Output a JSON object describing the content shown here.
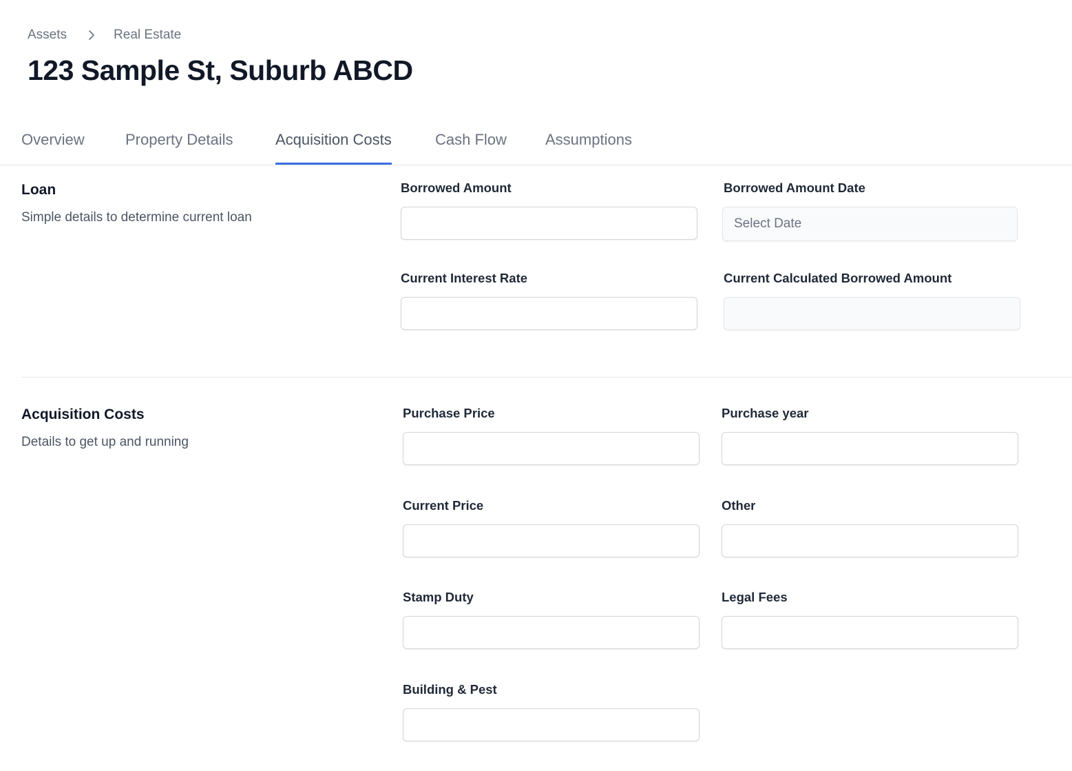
{
  "breadcrumb": {
    "items": [
      "Assets",
      "Real Estate"
    ]
  },
  "header": {
    "title": "123 Sample St, Suburb ABCD"
  },
  "tabs": [
    {
      "label": "Overview",
      "active": false
    },
    {
      "label": "Property Details",
      "active": false
    },
    {
      "label": "Acquisition Costs",
      "active": true
    },
    {
      "label": "Cash Flow",
      "active": false
    },
    {
      "label": "Assumptions",
      "active": false
    }
  ],
  "loan": {
    "title": "Loan",
    "description": "Simple details to determine current loan",
    "fields": {
      "borrowed_amount": {
        "label": "Borrowed Amount",
        "value": ""
      },
      "borrowed_amount_date": {
        "label": "Borrowed Amount Date",
        "placeholder": "Select Date",
        "value": ""
      },
      "current_interest_rate": {
        "label": "Current Interest Rate",
        "value": ""
      },
      "current_calculated_borrowed_amount": {
        "label": "Current Calculated Borrowed Amount",
        "value": ""
      }
    }
  },
  "acquisition": {
    "title": "Acquisition Costs",
    "description": "Details to get up and running",
    "fields": {
      "purchase_price": {
        "label": "Purchase Price",
        "value": ""
      },
      "purchase_year": {
        "label": "Purchase year",
        "value": ""
      },
      "current_price": {
        "label": "Current Price",
        "value": ""
      },
      "other": {
        "label": "Other",
        "value": ""
      },
      "stamp_duty": {
        "label": "Stamp Duty",
        "value": ""
      },
      "legal_fees": {
        "label": "Legal Fees",
        "value": ""
      },
      "building_pest": {
        "label": "Building & Pest",
        "value": ""
      }
    }
  },
  "colors": {
    "accent": "#3b6fe0",
    "text": "#111827",
    "muted": "#6b7280",
    "border": "#d1d5db"
  }
}
